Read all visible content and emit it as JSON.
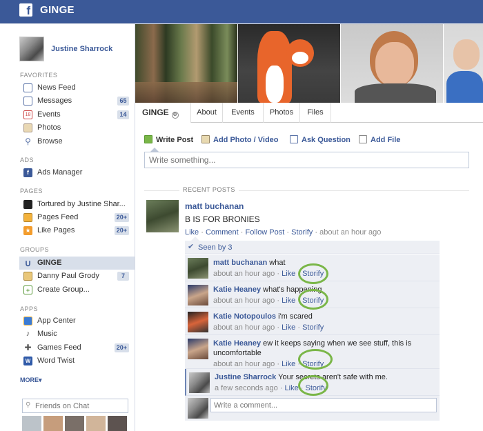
{
  "topbar": {
    "group_name": "GINGE",
    "logo_letter": "f"
  },
  "sidebar": {
    "profile_name": "Justine Sharrock",
    "sections": {
      "favorites": "FAVORITES",
      "ads": "ADS",
      "pages": "PAGES",
      "groups": "GROUPS",
      "apps": "APPS"
    },
    "favorites": [
      {
        "label": "News Feed",
        "icon": "news-feed-icon",
        "badge": ""
      },
      {
        "label": "Messages",
        "icon": "messages-icon",
        "badge": "65"
      },
      {
        "label": "Events",
        "icon": "events-icon",
        "badge": "14"
      },
      {
        "label": "Photos",
        "icon": "photos-icon",
        "badge": ""
      },
      {
        "label": "Browse",
        "icon": "browse-icon",
        "badge": ""
      }
    ],
    "ads": [
      {
        "label": "Ads Manager",
        "icon": "ads-manager-icon"
      }
    ],
    "pages": [
      {
        "label": "Tortured by Justine Shar...",
        "icon": "page-thumbnail-icon",
        "badge": ""
      },
      {
        "label": "Pages Feed",
        "icon": "pages-feed-icon",
        "badge": "20+"
      },
      {
        "label": "Like Pages",
        "icon": "like-pages-icon",
        "badge": "20+"
      }
    ],
    "groups": [
      {
        "label": "GINGE",
        "icon": "group-icon",
        "badge": ""
      },
      {
        "label": "Danny Paul Grody",
        "icon": "group-people-icon",
        "badge": "7"
      },
      {
        "label": "Create Group...",
        "icon": "create-group-icon",
        "badge": ""
      }
    ],
    "apps": [
      {
        "label": "App Center",
        "icon": "app-center-icon",
        "badge": ""
      },
      {
        "label": "Music",
        "icon": "music-icon",
        "badge": ""
      },
      {
        "label": "Games Feed",
        "icon": "games-feed-icon",
        "badge": "20+"
      },
      {
        "label": "Word Twist",
        "icon": "word-twist-icon",
        "badge": ""
      }
    ],
    "more_label": "MORE",
    "chat_placeholder": "Friends on Chat"
  },
  "tabs": {
    "group_name": "GINGE",
    "items": [
      "About",
      "Events",
      "Photos",
      "Files"
    ]
  },
  "composer": {
    "write_post": "Write Post",
    "add_photo": "Add Photo / Video",
    "ask_question": "Ask Question",
    "add_file": "Add File",
    "placeholder": "Write something..."
  },
  "feed": {
    "recent_posts_label": "RECENT POSTS",
    "post": {
      "author": "matt buchanan",
      "text": "B IS FOR BRONIES",
      "actions": {
        "like": "Like",
        "comment": "Comment",
        "follow": "Follow Post",
        "storify": "Storify",
        "time": "about an hour ago"
      }
    },
    "seen_by": "Seen by 3",
    "comments": [
      {
        "author": "matt buchanan",
        "text": "what",
        "time": "about an hour ago",
        "like": "Like",
        "storify": "Storify"
      },
      {
        "author": "Katie Heaney",
        "text": "what's happening",
        "time": "about an hour ago",
        "like": "Like",
        "storify": "Storify"
      },
      {
        "author": "Katie Notopoulos",
        "text": "i'm scared",
        "time": "about an hour ago",
        "like": "Like",
        "storify": "Storify"
      },
      {
        "author": "Katie Heaney",
        "text": "ew it keeps saying when we see stuff, this is uncomfortable",
        "time": "about an hour ago",
        "like": "Like",
        "storify": "Storify"
      },
      {
        "author": "Justine Sharrock",
        "text": "Your secrets aren't safe with me.",
        "time": "a few seconds ago",
        "like": "Like",
        "storify": "Storify"
      }
    ],
    "comment_placeholder": "Write a comment..."
  },
  "colors": {
    "brand_blue": "#3b5998",
    "storify_highlight": "#7ab648"
  }
}
